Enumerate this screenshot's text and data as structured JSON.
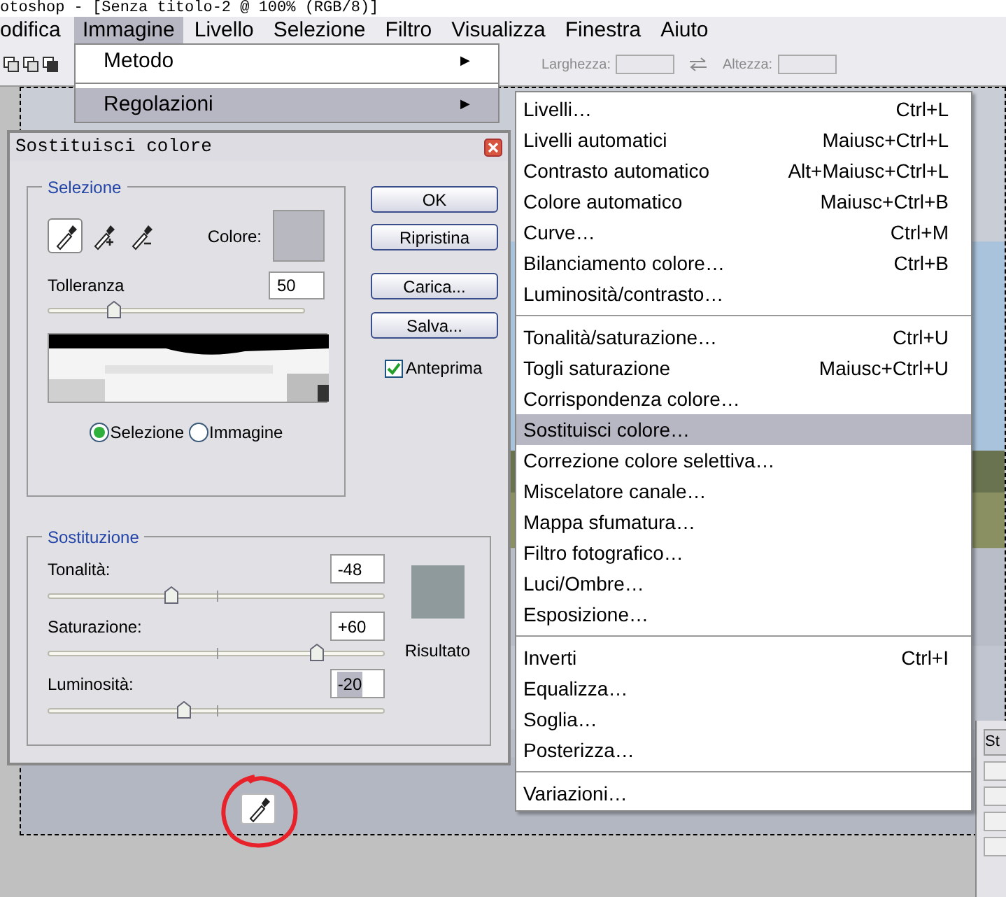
{
  "window": {
    "title": "otoshop - [Senza titolo-2 @ 100% (RGB/8)]"
  },
  "menubar": [
    {
      "label": "odifica",
      "selected": false
    },
    {
      "label": "Immagine",
      "selected": true
    },
    {
      "label": "Livello",
      "selected": false
    },
    {
      "label": "Selezione",
      "selected": false
    },
    {
      "label": "Filtro",
      "selected": false
    },
    {
      "label": "Visualizza",
      "selected": false
    },
    {
      "label": "Finestra",
      "selected": false
    },
    {
      "label": "Aiuto",
      "selected": false
    }
  ],
  "options_bar": {
    "width_label": "Larghezza:",
    "height_label": "Altezza:"
  },
  "image_menu": [
    {
      "label": "Metodo",
      "arrow": "▶",
      "selected": false
    },
    {
      "label": "Regolazioni",
      "arrow": "▶",
      "selected": true
    }
  ],
  "adjustments_menu": [
    [
      {
        "label": "Livelli…",
        "shortcut": "Ctrl+L",
        "selected": false
      },
      {
        "label": "Livelli automatici",
        "shortcut": "Maiusc+Ctrl+L",
        "selected": false
      },
      {
        "label": "Contrasto automatico",
        "shortcut": "Alt+Maiusc+Ctrl+L",
        "selected": false
      },
      {
        "label": "Colore automatico",
        "shortcut": "Maiusc+Ctrl+B",
        "selected": false
      },
      {
        "label": "Curve…",
        "shortcut": "Ctrl+M",
        "selected": false
      },
      {
        "label": "Bilanciamento colore…",
        "shortcut": "Ctrl+B",
        "selected": false
      },
      {
        "label": "Luminosità/contrasto…",
        "selected": false
      }
    ],
    [
      {
        "label": "Tonalità/saturazione…",
        "shortcut": "Ctrl+U",
        "selected": false
      },
      {
        "label": "Togli saturazione",
        "shortcut": "Maiusc+Ctrl+U",
        "selected": false
      },
      {
        "label": "Corrispondenza colore…",
        "selected": false
      },
      {
        "label": "Sostituisci colore…",
        "selected": true
      },
      {
        "label": "Correzione colore selettiva…",
        "selected": false
      },
      {
        "label": "Miscelatore canale…",
        "selected": false
      },
      {
        "label": "Mappa sfumatura…",
        "selected": false
      },
      {
        "label": "Filtro fotografico…",
        "selected": false
      },
      {
        "label": "Luci/Ombre…",
        "selected": false
      },
      {
        "label": "Esposizione…",
        "selected": false
      }
    ],
    [
      {
        "label": "Inverti",
        "shortcut": "Ctrl+I",
        "selected": false
      },
      {
        "label": "Equalizza…",
        "selected": false
      },
      {
        "label": "Soglia…",
        "selected": false
      },
      {
        "label": "Posterizza…",
        "selected": false
      }
    ],
    [
      {
        "label": "Variazioni…",
        "selected": false
      }
    ]
  ],
  "dialog": {
    "title": "Sostituisci colore",
    "selection": {
      "legend": "Selezione",
      "tools": [
        {
          "kind": "sample",
          "selected": true
        },
        {
          "kind": "add",
          "selected": false
        },
        {
          "kind": "subtract",
          "selected": false
        }
      ],
      "color_label": "Colore:",
      "tolerance": {
        "label": "Tolleranza",
        "value": "50",
        "level": 0.25
      },
      "radios": [
        {
          "label": "Selezione",
          "selected": true
        },
        {
          "label": "Immagine",
          "selected": false
        }
      ]
    },
    "buttons": [
      "OK",
      "Ripristina",
      "Carica...",
      "Salva..."
    ],
    "preview": {
      "label": "Anteprima",
      "checked": true
    },
    "replacement": {
      "legend": "Sostituzione",
      "sliders": [
        {
          "label": "Tonalità:",
          "value": "-48",
          "level": 0.365,
          "highlighted": false
        },
        {
          "label": "Saturazione:",
          "value": "+60",
          "level": 0.8,
          "highlighted": false
        },
        {
          "label": "Luminosità:",
          "value": "-20",
          "level": 0.4,
          "highlighted": true
        }
      ],
      "result_label": "Risultato"
    }
  },
  "panel_tab": "St"
}
